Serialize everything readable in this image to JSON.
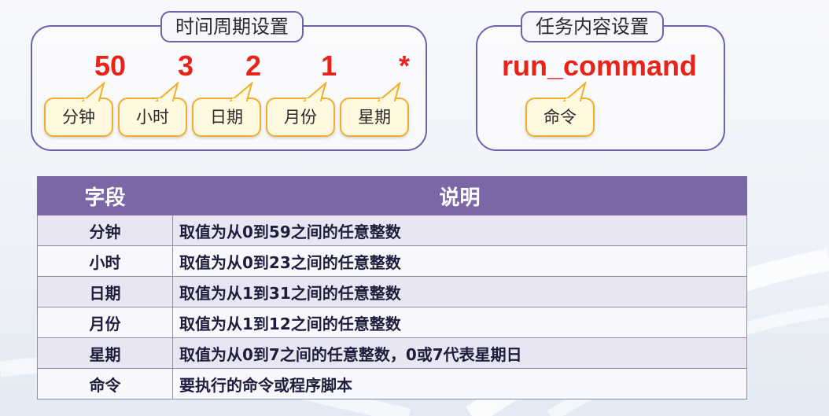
{
  "time_section": {
    "title": "时间周期设置",
    "fields": [
      {
        "value": "50",
        "label": "分钟"
      },
      {
        "value": "3",
        "label": "小时"
      },
      {
        "value": "2",
        "label": "日期"
      },
      {
        "value": "1",
        "label": "月份"
      },
      {
        "value": "*",
        "label": "星期"
      }
    ]
  },
  "task_section": {
    "title": "任务内容设置",
    "value": "run_command",
    "label": "命令"
  },
  "table": {
    "headers": [
      "字段",
      "说明"
    ],
    "rows": [
      {
        "field": "分钟",
        "desc": "取值为从0到59之间的任意整数"
      },
      {
        "field": "小时",
        "desc": "取值为从0到23之间的任意整数"
      },
      {
        "field": "日期",
        "desc": "取值为从1到31之间的任意整数"
      },
      {
        "field": "月份",
        "desc": "取值为从1到12之间的任意整数"
      },
      {
        "field": "星期",
        "desc": "取值为从0到7之间的任意整数，0或7代表星期日"
      },
      {
        "field": "命令",
        "desc": "要执行的命令或程序脚本"
      }
    ]
  },
  "colors": {
    "accent_purple": "#7c66a6",
    "value_red": "#e8231a",
    "bubble_border": "#f2ad2b",
    "bubble_fill": "#fff9df"
  }
}
